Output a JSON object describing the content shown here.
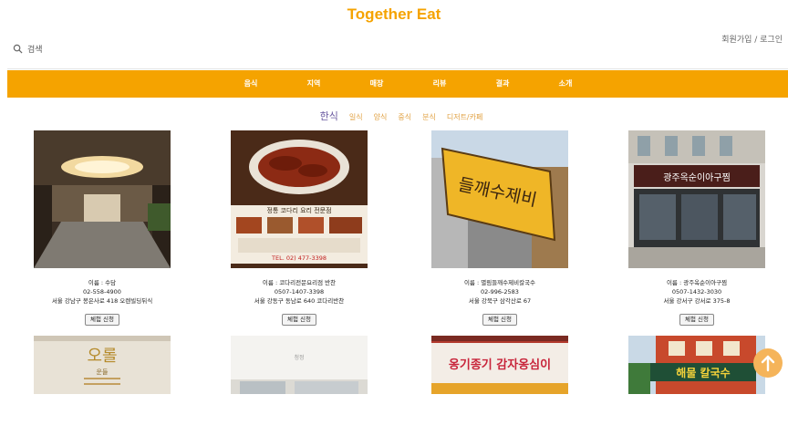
{
  "header": {
    "title": "Together Eat",
    "signup": "회원가입",
    "separator": " / ",
    "login": "로그인",
    "search_label": "검색"
  },
  "nav": {
    "items": [
      "음식",
      "지역",
      "매장",
      "리뷰",
      "결과",
      "소개"
    ]
  },
  "tabs": {
    "items": [
      "한식",
      "일식",
      "양식",
      "중식",
      "분식",
      "디저트/카페"
    ],
    "active": "한식"
  },
  "restaurants": [
    {
      "name": "이름 : 수담",
      "phone": "02-558-4900",
      "address": "서울 강남구 봉은사로 418 오렌빌딩뒤식",
      "button": "체험 신청"
    },
    {
      "name": "이름 : 코다리전문요리점 반찬",
      "phone": "0507-1407-3398",
      "address": "서울 강동구 동남로 640 코다리반찬",
      "button": "체험 신청"
    },
    {
      "name": "이름 : 별림들깨수제비칼국수",
      "phone": "02-996-2583",
      "address": "서울 강북구 삼각산로 67",
      "button": "체험 신청"
    },
    {
      "name": "이름 : 광주옥순이아구찜",
      "phone": "0507-1432-3030",
      "address": "서울 강서구 강서로 375-8",
      "button": "체험 신청"
    }
  ],
  "image_text": {
    "r2_caption": "정통 코다리 요리 전문점",
    "r2_tel": "TEL. 02) 477-3398",
    "r3_sign": "들깨수제비",
    "r4_sign": "광주옥순이아구찜",
    "b1_sign": "오롤",
    "b1_sub": "운들",
    "b2_sign": "청정",
    "b3_sign": "옹기종기 감자옹심이",
    "b4_sign": "해물 칼국수"
  },
  "colors": {
    "accent": "#f5a300",
    "tab_active": "#6a5aa0",
    "tab": "#e0a040"
  }
}
